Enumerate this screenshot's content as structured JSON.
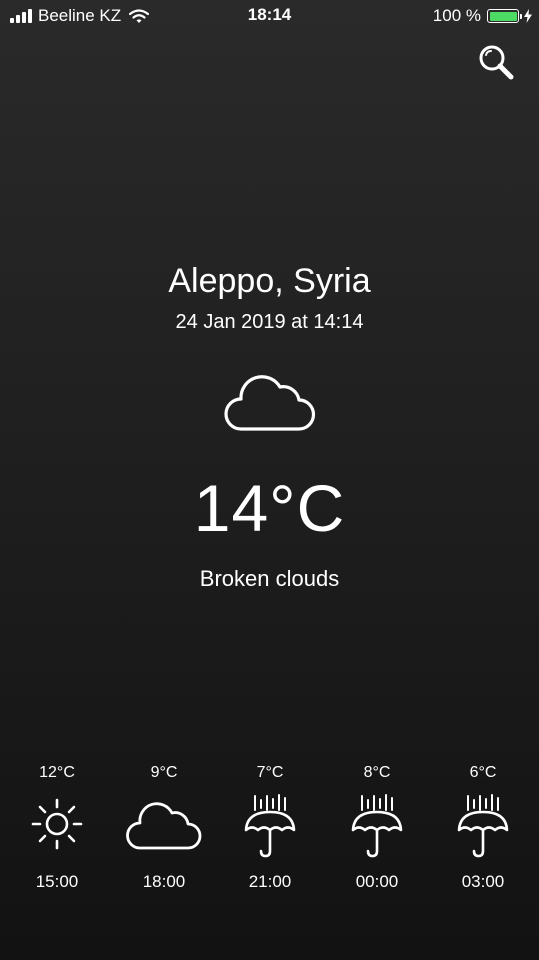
{
  "status_bar": {
    "carrier": "Beeline KZ",
    "time": "18:14",
    "battery_percent": "100 %",
    "battery_color": "#4cd964"
  },
  "header": {
    "search_icon": "search-icon"
  },
  "current": {
    "city": "Aleppo, Syria",
    "datetime": "24 Jan 2019 at 14:14",
    "icon": "cloud-icon",
    "temperature": "14°C",
    "condition": "Broken clouds"
  },
  "forecast": [
    {
      "temp": "12°C",
      "time": "15:00",
      "icon": "sun-icon"
    },
    {
      "temp": "9°C",
      "time": "18:00",
      "icon": "cloud-icon"
    },
    {
      "temp": "7°C",
      "time": "21:00",
      "icon": "umbrella-rain-icon"
    },
    {
      "temp": "8°C",
      "time": "00:00",
      "icon": "umbrella-rain-icon"
    },
    {
      "temp": "6°C",
      "time": "03:00",
      "icon": "umbrella-rain-icon"
    }
  ]
}
